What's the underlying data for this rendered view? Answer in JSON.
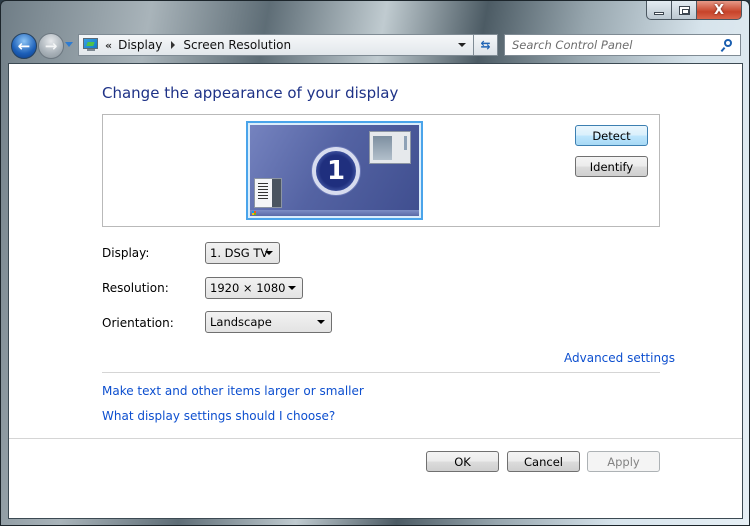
{
  "window": {
    "caption_buttons": {
      "minimize_icon": "minimize-icon",
      "maximize_icon": "maximize-icon",
      "close_icon": "close-icon",
      "close_glyph": "X"
    }
  },
  "nav": {
    "back_glyph": "←",
    "forward_glyph": "→",
    "address": {
      "icon": "display-control-panel-icon",
      "overflow_glyph": "«",
      "breadcrumbs": [
        "Display",
        "Screen Resolution"
      ]
    },
    "refresh_glyph": "⇆",
    "search": {
      "placeholder": "Search Control Panel",
      "value": ""
    }
  },
  "main": {
    "title": "Change the appearance of your display",
    "monitor": {
      "number": "1"
    },
    "detect_label": "Detect",
    "identify_label": "Identify",
    "fields": {
      "display": {
        "label": "Display:",
        "value": "1. DSG TV"
      },
      "resolution": {
        "label": "Resolution:",
        "value": "1920 × 1080"
      },
      "orientation": {
        "label": "Orientation:",
        "value": "Landscape"
      }
    },
    "advanced_settings": "Advanced settings",
    "links": [
      "Make text and other items larger or smaller",
      "What display settings should I choose?"
    ]
  },
  "footer": {
    "ok_label": "OK",
    "cancel_label": "Cancel",
    "apply_label": "Apply",
    "apply_enabled": false
  }
}
